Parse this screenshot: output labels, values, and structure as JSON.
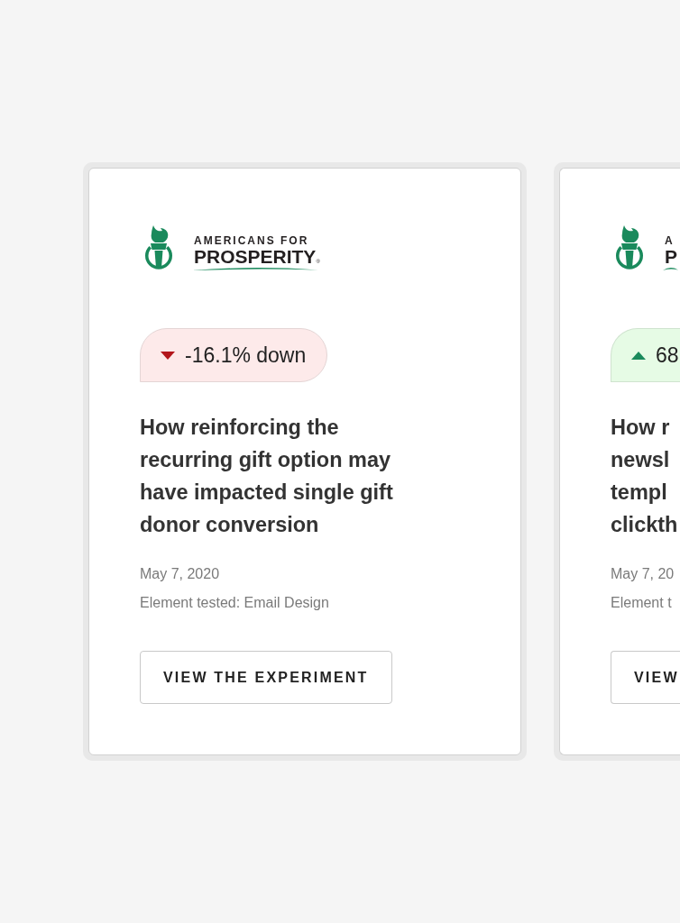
{
  "cards": [
    {
      "logo": {
        "line_1": "AMERICANS FOR",
        "line_2": "PROSPERITY",
        "registered_mark": "®"
      },
      "trend": {
        "kind": "down",
        "text": "-16.1% down"
      },
      "title_lines": [
        "How reinforcing the",
        "recurring gift option may",
        "have impacted single gift",
        "donor conversion"
      ],
      "date": "May 7, 2020",
      "element_tested": "Element tested: Email Design",
      "button": "VIEW THE EXPERIMENT"
    },
    {
      "logo": {
        "line_1": "A",
        "line_2": "P"
      },
      "trend": {
        "kind": "up",
        "text": "68"
      },
      "title_lines": [
        "How r",
        "newsl",
        "templ",
        "clickth"
      ],
      "date": "May 7, 20",
      "element_tested": "Element t",
      "button": "VIEW"
    }
  ]
}
